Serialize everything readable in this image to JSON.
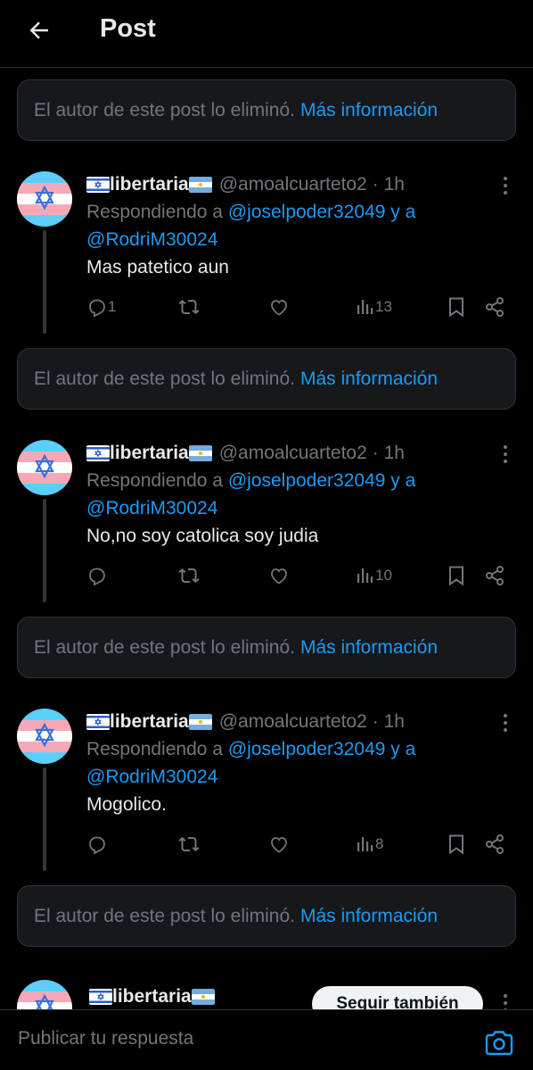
{
  "header": {
    "title": "Post",
    "back_icon": "arrow-left-icon"
  },
  "deleted_notice": {
    "text": "El autor de este post lo eliminó.",
    "more": "Más información"
  },
  "tweets": [
    {
      "name": "libertaria",
      "handle": "@amoalcuarteto2",
      "time": "· 1h",
      "reply_prefix": "Respondiendo a",
      "reply_user1": "@joselpoder32049",
      "reply_and": "y a",
      "reply_user2": "@RodriM30024",
      "text": "Mas patetico aun",
      "replies": "1",
      "retweets": "",
      "likes": "",
      "views": "13"
    },
    {
      "name": "libertaria",
      "handle": "@amoalcuarteto2",
      "time": "· 1h",
      "reply_prefix": "Respondiendo a",
      "reply_user1": "@joselpoder32049",
      "reply_and": "y a",
      "reply_user2": "@RodriM30024",
      "text": "No,no soy catolica soy judia",
      "replies": "",
      "retweets": "",
      "likes": "",
      "views": "10"
    },
    {
      "name": "libertaria",
      "handle": "@amoalcuarteto2",
      "time": "· 1h",
      "reply_prefix": "Respondiendo a",
      "reply_user1": "@joselpoder32049",
      "reply_and": "y a",
      "reply_user2": "@RodriM30024",
      "text": "Mogolico.",
      "replies": "",
      "retweets": "",
      "likes": "",
      "views": "8"
    }
  ],
  "partial_tweet": {
    "name": "libertaria",
    "follow_label": "Seguir también"
  },
  "composer": {
    "placeholder": "Publicar tu respuesta",
    "camera_icon": "camera-icon"
  },
  "colors": {
    "background": "#000000",
    "accent": "#1d9bf0",
    "muted": "#71767b",
    "text": "#e7e9ea",
    "border": "#2f3336"
  }
}
